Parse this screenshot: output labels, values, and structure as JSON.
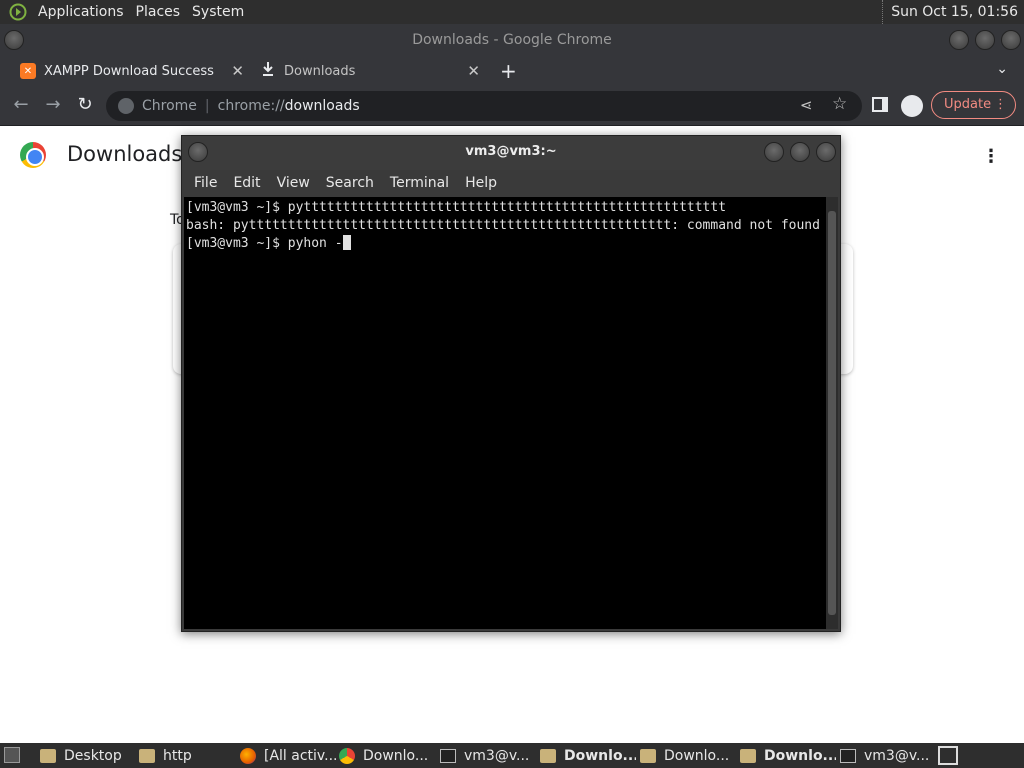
{
  "top_panel": {
    "menus": [
      "Applications",
      "Places",
      "System"
    ],
    "clock": "Sun Oct 15, 01:56"
  },
  "chrome": {
    "window_title": "Downloads - Google Chrome",
    "tabs": [
      {
        "label": "XAMPP Download Success",
        "icon": "xampp-icon",
        "active": true
      },
      {
        "label": "Downloads",
        "icon": "download-icon",
        "active": false
      }
    ],
    "omnibox": {
      "scheme_label": "Chrome",
      "url_prefix": "chrome://",
      "url_host": "downloads"
    },
    "update_label": "Update"
  },
  "downloads_page": {
    "title": "Downloads",
    "today_label": "To"
  },
  "terminal": {
    "title": "vm3@vm3:~",
    "menu": [
      "File",
      "Edit",
      "View",
      "Search",
      "Terminal",
      "Help"
    ],
    "lines": [
      "[vm3@vm3 ~]$ pytttttttttttttttttttttttttttttttttttttttttttttttttttttt",
      "bash: pytttttttttttttttttttttttttttttttttttttttttttttttttttttt: command not found",
      "[vm3@vm3 ~]$ pyhon -"
    ]
  },
  "taskbar": {
    "items": [
      {
        "label": "Desktop",
        "icon": "folder-icon",
        "bold": false
      },
      {
        "label": "http",
        "icon": "folder-icon",
        "bold": false
      },
      {
        "label": "[All activ...",
        "icon": "firefox-icon",
        "bold": false
      },
      {
        "label": "Downlo...",
        "icon": "chrome-icon",
        "bold": false
      },
      {
        "label": "vm3@v...",
        "icon": "terminal-icon",
        "bold": false
      },
      {
        "label": "Downlo...",
        "icon": "folder-icon",
        "bold": true
      },
      {
        "label": "Downlo...",
        "icon": "folder-icon",
        "bold": false
      },
      {
        "label": "Downlo...",
        "icon": "folder-icon",
        "bold": true
      },
      {
        "label": "vm3@v...",
        "icon": "terminal-icon",
        "bold": false
      }
    ]
  }
}
